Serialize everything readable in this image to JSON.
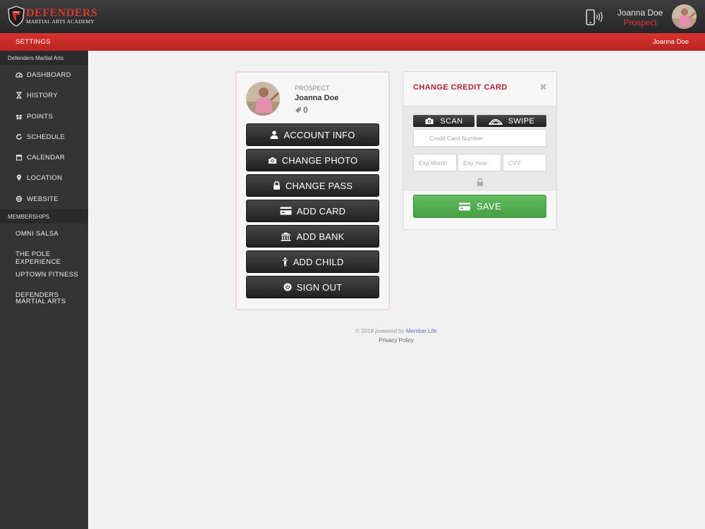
{
  "header": {
    "logo_title": "DEFENDERS",
    "logo_subtitle": "MARTIAL ARTS ACADEMY",
    "user_name": "Joanna Doe",
    "user_role": "Prospect"
  },
  "subheader": {
    "left_label": "SETTINGS",
    "right_label": "Joanna Doe"
  },
  "sidebar": {
    "section_title": "Defenders Martial Arts",
    "items": [
      {
        "label": "DASHBOARD",
        "icon": "dashboard-icon"
      },
      {
        "label": "HISTORY",
        "icon": "hourglass-icon"
      },
      {
        "label": "POINTS",
        "icon": "gift-icon"
      },
      {
        "label": "SCHEDULE",
        "icon": "refresh-icon"
      },
      {
        "label": "CALENDAR",
        "icon": "calendar-icon"
      },
      {
        "label": "LOCATION",
        "icon": "map-pin-icon"
      },
      {
        "label": "WEBSITE",
        "icon": "globe-icon"
      }
    ],
    "memberships_title": "MEMBERSHIPS",
    "memberships": [
      "OMNI SALSA",
      "THE POLE EXPERIENCE",
      "UPTOWN FITNESS",
      "DEFENDERS MARTIAL ARTS"
    ]
  },
  "profile": {
    "role": "PROSPECT",
    "name": "Joanna Doe",
    "points": "0",
    "actions": [
      {
        "label": "ACCOUNT INFO",
        "icon": "user-icon"
      },
      {
        "label": "CHANGE PHOTO",
        "icon": "camera-icon"
      },
      {
        "label": "CHANGE PASS",
        "icon": "lock-icon"
      },
      {
        "label": "ADD CARD",
        "icon": "credit-card-icon"
      },
      {
        "label": "ADD BANK",
        "icon": "bank-icon"
      },
      {
        "label": "ADD CHILD",
        "icon": "child-icon"
      },
      {
        "label": "SIGN OUT",
        "icon": "power-icon"
      }
    ]
  },
  "credit_card": {
    "title": "CHANGE CREDIT CARD",
    "close": "✖",
    "scan_label": "SCAN",
    "swipe_label": "SWIPE",
    "card_number_placeholder": "Credit Card Number",
    "exp_month_placeholder": "Exp Month",
    "exp_year_placeholder": "Exp Year",
    "cvv_placeholder": "CVV",
    "save_label": "SAVE"
  },
  "footer": {
    "copyright": "© 2018",
    "powered_by": "powered by",
    "brand": "Member.Life",
    "privacy": "Privacy Policy"
  },
  "colors": {
    "accent_red": "#c8302b",
    "save_green": "#55ad50",
    "sidebar_bg": "#343434"
  }
}
